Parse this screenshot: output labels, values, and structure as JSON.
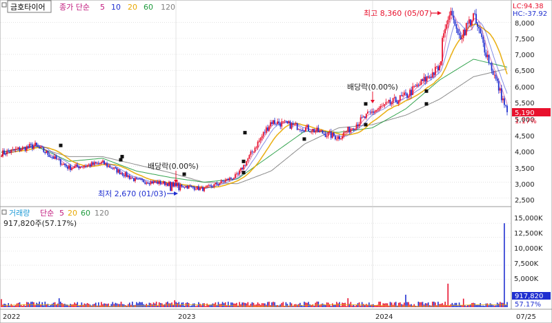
{
  "header": {
    "stock_name": "금호타이어",
    "ma_title": "종가 단순",
    "ma_periods": [
      "5",
      "10",
      "20",
      "60",
      "120"
    ],
    "ma_colors": [
      "#c0187c",
      "#1f2fd0",
      "#e8a800",
      "#1e9a3c",
      "#808080"
    ]
  },
  "indicators": {
    "lc": "LC:94.38",
    "hc": "HC:-37.92"
  },
  "price_panel": {
    "y_ticks": [
      "8,000",
      "7,500",
      "7,000",
      "6,500",
      "6,000",
      "5,500",
      "5,000",
      "4,500",
      "4,000",
      "3,500",
      "3,000",
      "2,500"
    ],
    "current_price": "5,190",
    "current_change": "1.17%",
    "high_annotation": "최고 8,360 (05/07)",
    "low_annotation": "최저 2,670 (01/03)",
    "dividend_labels": [
      "배당락(0.00%)",
      "배당락(0.00%)"
    ]
  },
  "volume_panel": {
    "title": "거래량",
    "ma_title": "단순",
    "ma_periods": [
      "5",
      "20",
      "60",
      "120"
    ],
    "ma_colors": [
      "#c0187c",
      "#e8a800",
      "#1e9a3c",
      "#808080"
    ],
    "current_volume": "917,820주(57.17%)",
    "y_ticks": [
      "15,000K",
      "12,500K",
      "10,000K",
      "7,500K",
      "5,000K"
    ],
    "current_value_tag": "917,820",
    "current_pct_tag": "57.17%"
  },
  "x_axis": {
    "labels": [
      "2022",
      "2023",
      "2024",
      "07/25"
    ]
  },
  "colors": {
    "up": "#e8112d",
    "down": "#1f2fd0",
    "price_tag_bg": "#e8112d",
    "volume_tag_bg": "#1f2fd0",
    "grid": "#d0d0d0"
  },
  "chart_data": {
    "type": "candlestick",
    "price_range": [
      2300,
      8400
    ],
    "x": [
      "2022-01",
      "2022-03",
      "2022-05",
      "2022-07",
      "2022-09",
      "2022-11",
      "2023-01",
      "2023-03",
      "2023-05",
      "2023-07",
      "2023-09",
      "2023-11",
      "2024-01",
      "2024-03",
      "2024-05",
      "2024-07"
    ],
    "series": [
      {
        "values": [
          3900,
          4150,
          3450,
          3600,
          3050,
          2950,
          2780,
          3200,
          4900,
          4700,
          4400,
          5200,
          5700,
          6600,
          8200,
          5190
        ]
      },
      {
        "values": [
          3930,
          4150,
          3650,
          3750,
          3350,
          3150,
          3000,
          3100,
          3850,
          4600,
          4560,
          4700,
          5300,
          6200,
          6850,
          6600
        ]
      },
      {
        "values": [
          3950,
          4100,
          3800,
          3800,
          3550,
          3300,
          3000,
          2950,
          3350,
          4200,
          4700,
          4800,
          5100,
          5600,
          6300,
          6550
        ]
      }
    ],
    "volume_ylim": [
      0,
      16000000
    ],
    "volume_peak": 15000000,
    "volume_current": 917820,
    "annotations": {
      "high": 8360,
      "low": 2670,
      "last": 5190
    }
  }
}
